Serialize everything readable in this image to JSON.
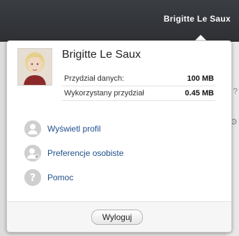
{
  "topbar": {
    "user_name": "Brigitte Le Saux"
  },
  "profile": {
    "name": "Brigitte Le Saux",
    "quota_label": "Przydział danych:",
    "quota_value": "100 MB",
    "used_label": "Wykorzystany przydział",
    "used_value": "0.45 MB"
  },
  "menu": {
    "items": [
      {
        "label": "Wyświetl profil",
        "icon": "person-icon"
      },
      {
        "label": "Preferencje osobiste",
        "icon": "person-settings-icon"
      },
      {
        "label": "Pomoc",
        "icon": "help-icon"
      }
    ]
  },
  "footer": {
    "logout_label": "Wyloguj"
  },
  "colors": {
    "topbar": "#2e3034",
    "link": "#1f4f8a",
    "icon": "#cfcfcf"
  }
}
